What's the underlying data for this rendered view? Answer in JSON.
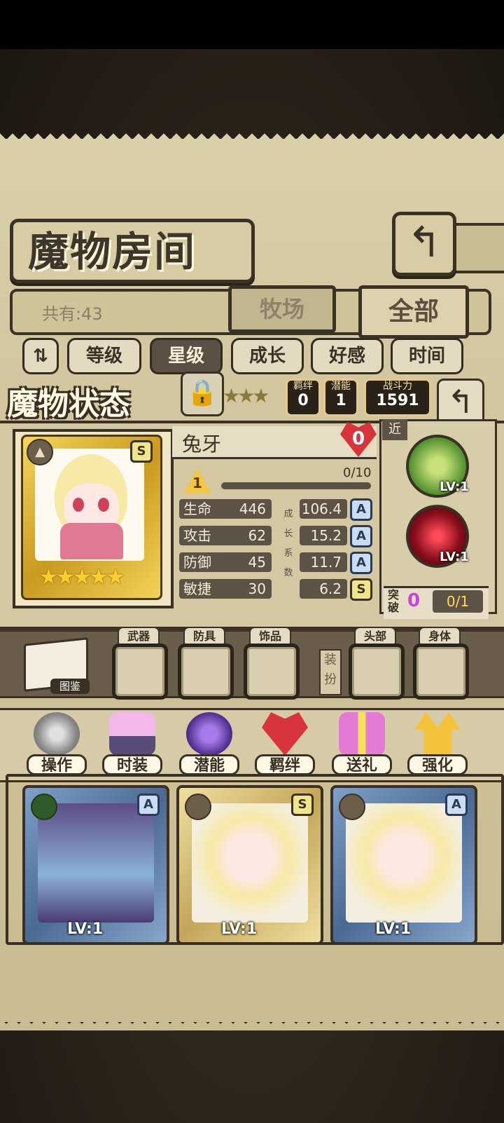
{
  "title": "魔物房间",
  "count_label": "共有:43",
  "tabs": {
    "ranch": "牧场",
    "all": "全部"
  },
  "sort": {
    "items": [
      "等级",
      "星级",
      "成长",
      "好感",
      "时间"
    ],
    "active_index": 1
  },
  "status": {
    "title": "魔物状态",
    "bond_label": "羁绊",
    "bond_value": "0",
    "potential_label": "潜能",
    "potential_value": "1",
    "power_label": "战斗力",
    "power_value": "1591"
  },
  "monster": {
    "name": "兔牙",
    "affinity": "0",
    "level": "1",
    "exp": "0/10",
    "grade": "S",
    "stars": "★★★★★",
    "stats": [
      {
        "label": "生命",
        "value": "446",
        "growth": "106.4",
        "grade": "A"
      },
      {
        "label": "攻击",
        "value": "62",
        "growth": "15.2",
        "grade": "A"
      },
      {
        "label": "防御",
        "value": "45",
        "growth": "11.7",
        "grade": "A"
      },
      {
        "label": "敏捷",
        "value": "30",
        "growth": "6.2",
        "grade": "S"
      }
    ],
    "growth_label": [
      "成",
      "长",
      "系",
      "数"
    ],
    "range_tab": "近",
    "skill1_lv": "LV:1",
    "skill2_lv": "LV:1",
    "breakthrough_label": "突破",
    "breakthrough_value": "0",
    "breakthrough_progress": "0/1"
  },
  "equipment": {
    "codex_label": "图鉴",
    "slots": [
      "武器",
      "防具",
      "饰品"
    ],
    "dress_label": "装扮",
    "dress_slots": [
      "头部",
      "身体"
    ]
  },
  "actions": [
    "操作",
    "时装",
    "潜能",
    "羁绊",
    "送礼",
    "强化"
  ],
  "cards": [
    {
      "level": "LV:1",
      "grade": "A",
      "frame": "blue"
    },
    {
      "level": "LV:1",
      "grade": "S",
      "frame": "gold"
    },
    {
      "level": "LV:1",
      "grade": "A",
      "frame": "blue"
    }
  ],
  "colors": {
    "parchment": "#d3c8a2",
    "ink": "#3a3023",
    "gold_star": "#ffcf2e",
    "heart": "#d8343c"
  }
}
